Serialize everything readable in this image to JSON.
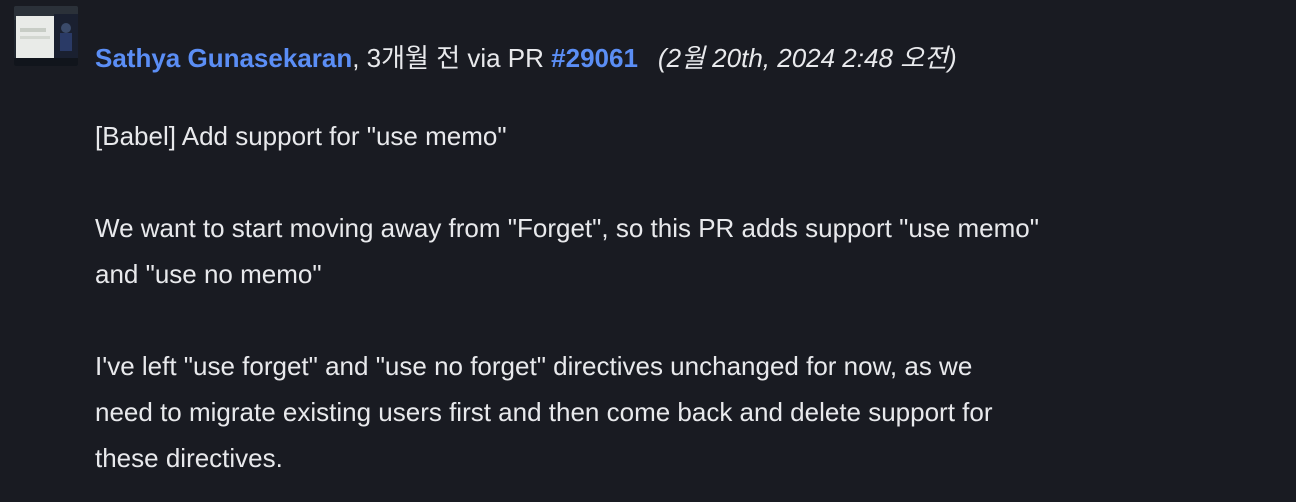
{
  "commit": {
    "author": "Sathya Gunasekaran",
    "relative_time": ", 3개월 전 via PR ",
    "pr_number": "#29061",
    "date": "(2월 20th, 2024 2:48 오전)",
    "message": [
      "[Babel] Add support for \"use memo\"",
      "We want to start moving away from \"Forget\", so this PR adds support \"use memo\"\nand \"use no memo\"",
      "I've left \"use forget\" and \"use no forget\" directives unchanged for now, as we\nneed to migrate existing users first and then come back and delete support for\nthese directives."
    ]
  }
}
